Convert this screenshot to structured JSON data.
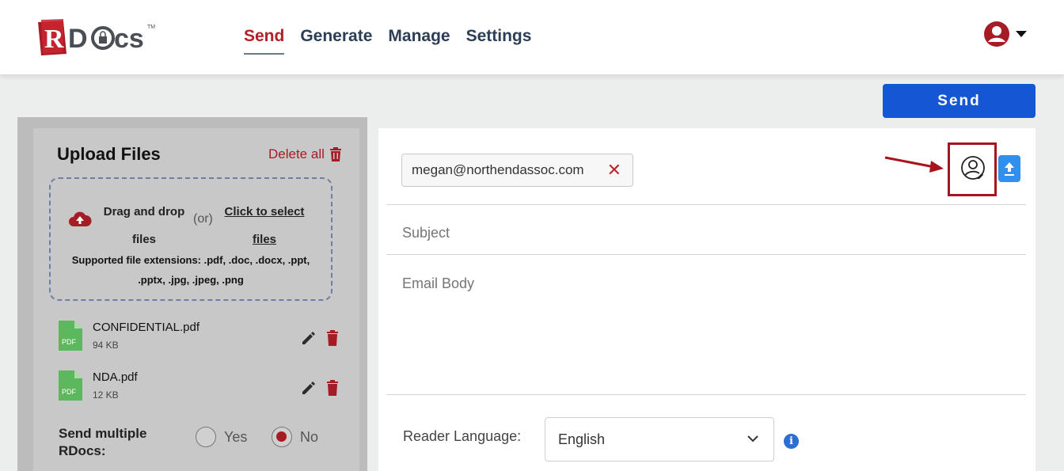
{
  "app": {
    "logo_text": "RDocs"
  },
  "nav": {
    "items": [
      {
        "label": "Send",
        "active": true
      },
      {
        "label": "Generate",
        "active": false
      },
      {
        "label": "Manage",
        "active": false
      },
      {
        "label": "Settings",
        "active": false
      }
    ]
  },
  "header": {
    "avatar_icon": "user-circle-icon",
    "menu_icon": "caret-down-icon"
  },
  "toolbar": {
    "send_label": "Send"
  },
  "upload": {
    "title": "Upload Files",
    "delete_all_label": "Delete all",
    "dropzone": {
      "drag_text": "Drag and drop files",
      "or_text": "(or)",
      "click_text": "Click to select files",
      "extensions_text": "Supported file extensions: .pdf, .doc, .docx, .ppt, .pptx, .jpg, .jpeg, .png"
    },
    "files": [
      {
        "name": "CONFIDENTIAL.pdf",
        "size": "94 KB",
        "icon_label": "PDF"
      },
      {
        "name": "NDA.pdf",
        "size": "12 KB",
        "icon_label": "PDF"
      }
    ],
    "multiple": {
      "label": "Send multiple RDocs:",
      "options": [
        {
          "label": "Yes",
          "checked": false
        },
        {
          "label": "No",
          "checked": true
        }
      ]
    }
  },
  "compose": {
    "recipients": [
      {
        "email": "megan@northendassoc.com"
      }
    ],
    "subject_placeholder": "Subject",
    "body_placeholder": "Email Body",
    "reader_language_label": "Reader Language:",
    "reader_language_value": "English",
    "info_icon_text": "i"
  },
  "colors": {
    "brand_red": "#a51c25",
    "primary_blue": "#1456d3",
    "accent_blue": "#2f90f0"
  }
}
